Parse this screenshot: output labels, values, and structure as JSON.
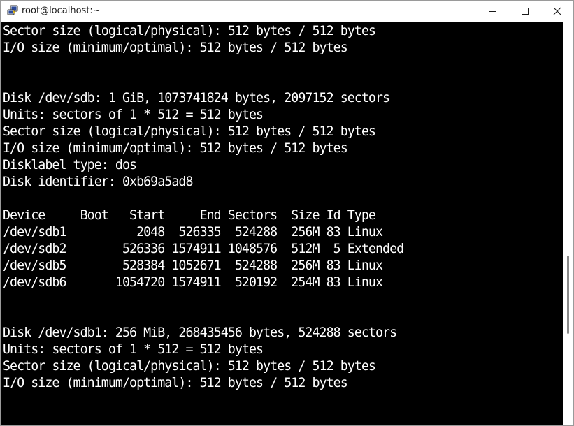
{
  "window": {
    "title": "root@localhost:~",
    "icon": "putty-icon",
    "controls": [
      "minimize-icon",
      "maximize-icon",
      "close-icon"
    ]
  },
  "terminal": {
    "lines": [
      "Sector size (logical/physical): 512 bytes / 512 bytes",
      "I/O size (minimum/optimal): 512 bytes / 512 bytes",
      "",
      "",
      "Disk /dev/sdb: 1 GiB, 1073741824 bytes, 2097152 sectors",
      "Units: sectors of 1 * 512 = 512 bytes",
      "Sector size (logical/physical): 512 bytes / 512 bytes",
      "I/O size (minimum/optimal): 512 bytes / 512 bytes",
      "Disklabel type: dos",
      "Disk identifier: 0xb69a5ad8",
      "",
      "Device     Boot   Start     End Sectors  Size Id Type",
      "/dev/sdb1          2048  526335  524288  256M 83 Linux",
      "/dev/sdb2        526336 1574911 1048576  512M  5 Extended",
      "/dev/sdb5        528384 1052671  524288  256M 83 Linux",
      "/dev/sdb6       1054720 1574911  520192  254M 83 Linux",
      "",
      "",
      "Disk /dev/sdb1: 256 MiB, 268435456 bytes, 524288 sectors",
      "Units: sectors of 1 * 512 = 512 bytes",
      "Sector size (logical/physical): 512 bytes / 512 bytes",
      "I/O size (minimum/optimal): 512 bytes / 512 bytes"
    ]
  }
}
